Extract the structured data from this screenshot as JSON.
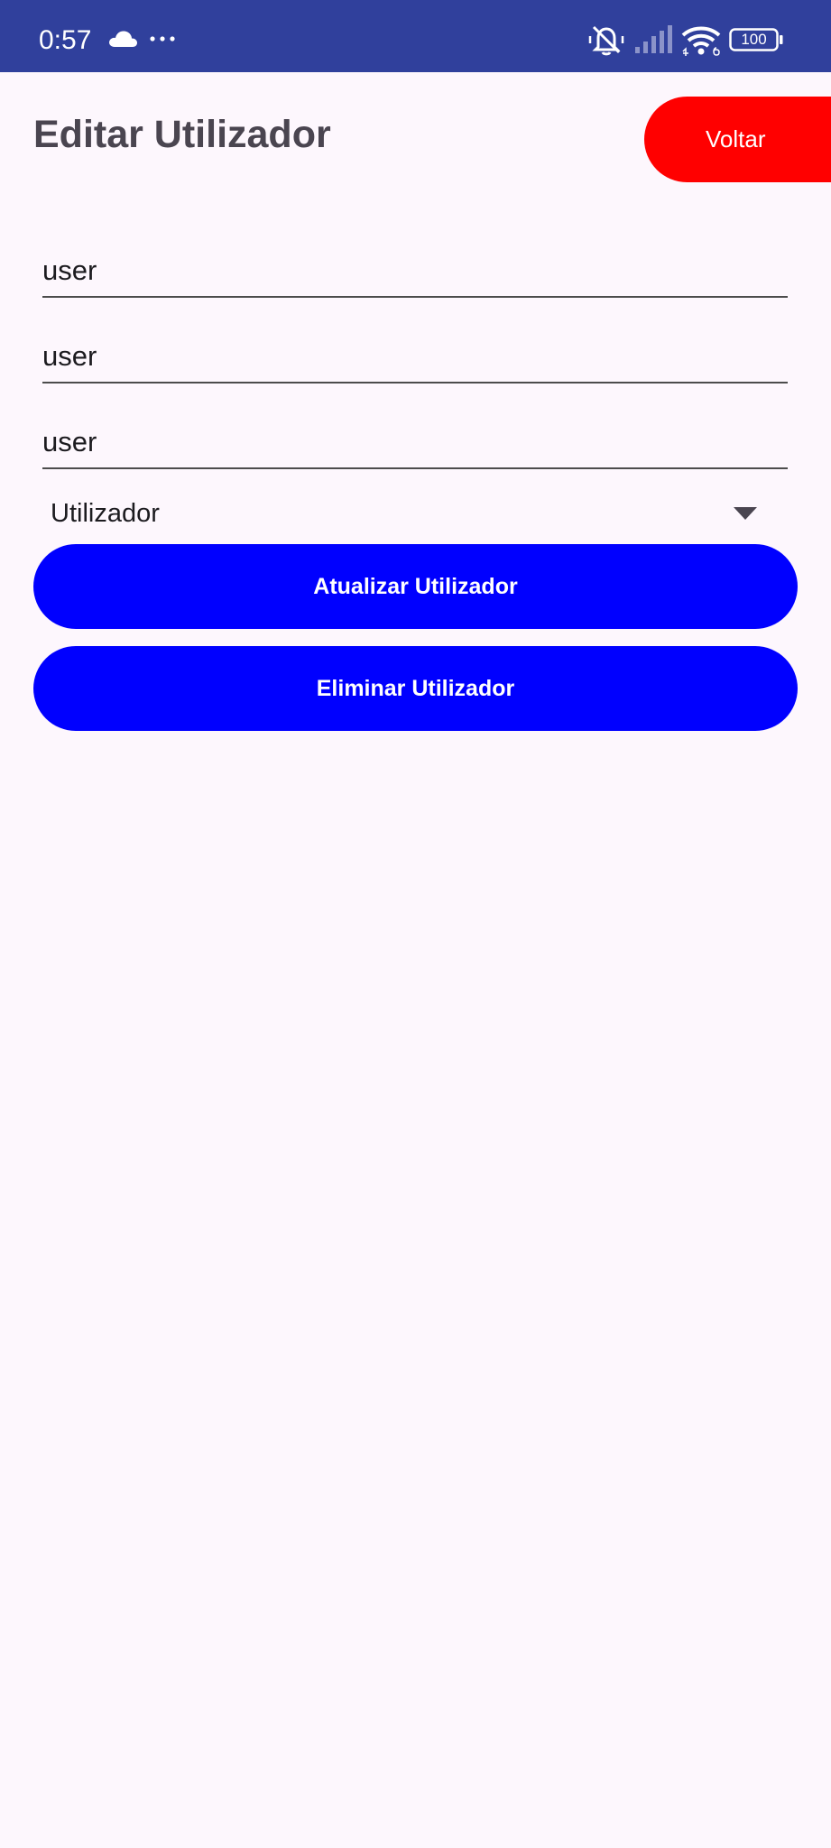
{
  "status_bar": {
    "time": "0:57",
    "battery_level": "100",
    "icons": [
      "cloud-icon",
      "more-dots-icon",
      "bell-muted-icon",
      "signal-icon",
      "wifi-icon",
      "battery-icon"
    ],
    "background_color": "#30409c"
  },
  "header": {
    "title": "Editar Utilizador",
    "back_label": "Voltar",
    "back_color": "#ff0000"
  },
  "form": {
    "fields": [
      {
        "value": "user"
      },
      {
        "value": "user"
      },
      {
        "value": "user"
      }
    ],
    "role_selected": "Utilizador"
  },
  "actions": {
    "update_label": "Atualizar Utilizador",
    "delete_label": "Eliminar Utilizador",
    "button_color": "#0000ff"
  }
}
